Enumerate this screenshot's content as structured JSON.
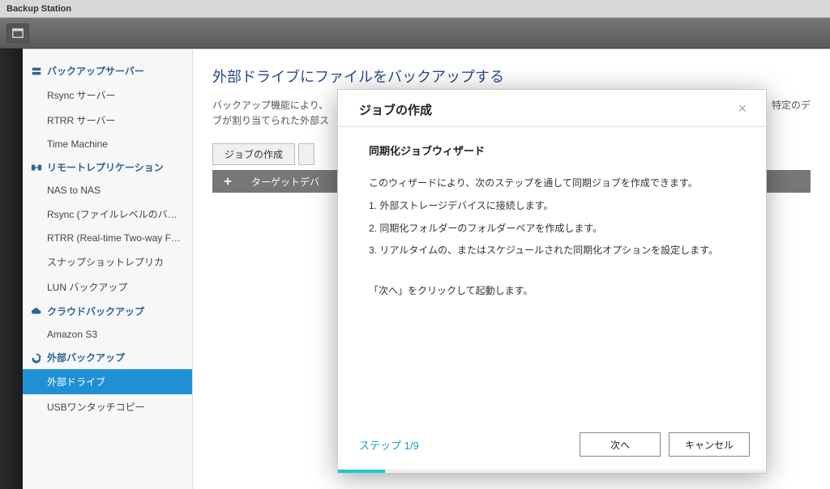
{
  "window": {
    "title": "Backup Station"
  },
  "sidebar": {
    "groups": [
      {
        "label": "バックアップサーバー",
        "items": [
          {
            "label": "Rsync サーバー"
          },
          {
            "label": "RTRR サーバー"
          },
          {
            "label": "Time Machine"
          }
        ]
      },
      {
        "label": "リモートレプリケーション",
        "items": [
          {
            "label": "NAS to NAS"
          },
          {
            "label": "Rsync (ファイルレベルのバック..."
          },
          {
            "label": "RTRR (Real-time Two-way Folde..."
          },
          {
            "label": "スナップショットレプリカ"
          },
          {
            "label": "LUN バックアップ"
          }
        ]
      },
      {
        "label": "クラウドバックアップ",
        "items": [
          {
            "label": "Amazon S3"
          }
        ]
      },
      {
        "label": "外部バックアップ",
        "items": [
          {
            "label": "外部ドライブ",
            "active": true
          },
          {
            "label": "USBワンタッチコピー"
          }
        ]
      }
    ]
  },
  "content": {
    "heading": "外部ドライブにファイルをバックアップする",
    "description_prefix": "バックアップ機能により、",
    "description_suffix": "して、特定のデ",
    "description_line2": "ブが割り当てられた外部ス",
    "buttons": {
      "create_job": "ジョブの作成"
    },
    "table": {
      "col_target": "ターゲットデバ"
    }
  },
  "modal": {
    "title": "ジョブの作成",
    "subtitle": "同期化ジョブウィザード",
    "intro": "このウィザードにより、次のステップを通して同期ジョブを作成できます。",
    "steps": [
      "1. 外部ストレージデバイスに接続します。",
      "2. 同期化フォルダーのフォルダーペアを作成します。",
      "3. リアルタイムの、またはスケジュールされた同期化オプションを設定します。"
    ],
    "note": "「次へ」をクリックして起動します。",
    "step_indicator": "ステップ 1/9",
    "buttons": {
      "next": "次へ",
      "cancel": "キャンセル"
    }
  }
}
